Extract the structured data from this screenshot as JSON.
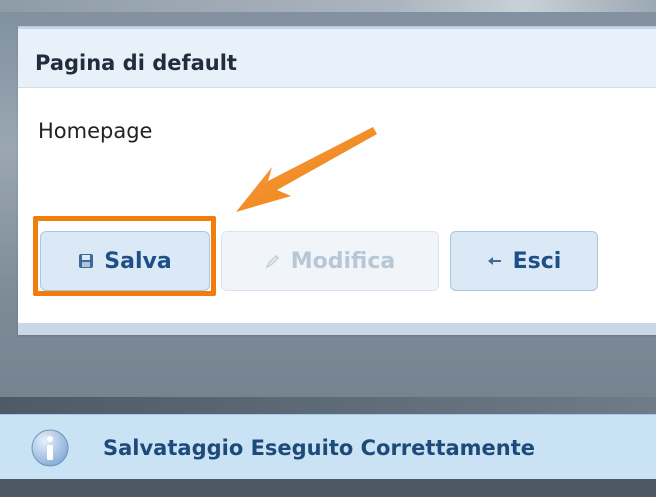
{
  "panel": {
    "title": "Pagina di default",
    "value": "Homepage"
  },
  "buttons": {
    "save": {
      "label": "Salva",
      "icon": "floppy-disk-icon"
    },
    "edit": {
      "label": "Modifica",
      "icon": "pencil-icon",
      "state": "disabled"
    },
    "exit": {
      "label": "Esci",
      "icon": "arrow-left-icon"
    }
  },
  "notification": {
    "message": "Salvataggio Eseguito Correttamente",
    "icon": "info-icon"
  },
  "annotation": {
    "highlight_color": "#f07d0c",
    "arrow_color": "#f07d0c",
    "arrow_target": "save-button"
  },
  "colors": {
    "header_bg": "#e8f0f9",
    "button_bg": "#dbe9f7",
    "button_text": "#1e4f86",
    "notification_bg": "#c9e3f4",
    "notification_text": "#1e4a7a"
  }
}
